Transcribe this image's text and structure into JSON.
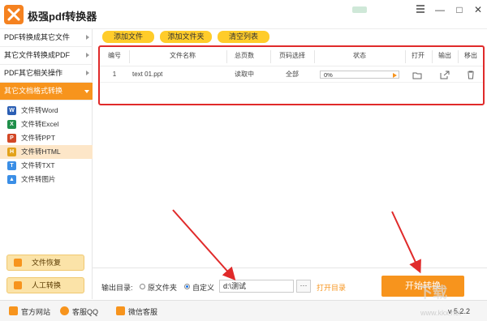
{
  "app": {
    "title": "极强pdf转换器",
    "window_controls": [
      "—",
      "□",
      "✕"
    ]
  },
  "sidebar": {
    "categories": [
      {
        "label": "PDF转换成其它文件",
        "active": false
      },
      {
        "label": "其它文件转换成PDF",
        "active": false
      },
      {
        "label": "PDF其它相关操作",
        "active": false
      },
      {
        "label": "其它文档格式转换",
        "active": true
      }
    ],
    "sub_items": [
      {
        "label": "文件转Word",
        "icon": "word-icon",
        "icon_color": "#2b5fb4",
        "active": false
      },
      {
        "label": "文件转Excel",
        "icon": "excel-icon",
        "icon_color": "#1f8f4a",
        "active": false
      },
      {
        "label": "文件转PPT",
        "icon": "ppt-icon",
        "icon_color": "#d24726",
        "active": false
      },
      {
        "label": "文件转HTML",
        "icon": "html-icon",
        "icon_color": "#e3a21a",
        "active": true
      },
      {
        "label": "文件转TXT",
        "icon": "txt-icon",
        "icon_color": "#3a8ee6",
        "active": false
      },
      {
        "label": "文件转图片",
        "icon": "image-icon",
        "icon_color": "#3a8ee6",
        "active": false
      }
    ],
    "bottom_buttons": [
      {
        "label": "文件恢复",
        "icon": "restore-icon"
      },
      {
        "label": "人工转换",
        "icon": "manual-convert-icon"
      }
    ]
  },
  "toolbar": {
    "add_file": "添加文件",
    "add_folder": "添加文件夹",
    "clear_list": "清空列表"
  },
  "table": {
    "headers": [
      "编号",
      "文件名称",
      "总页数",
      "页码选择",
      "状态",
      "打开",
      "输出",
      "移出"
    ],
    "rows": [
      {
        "index": "1",
        "filename": "text 01.ppt",
        "pages": "读取中",
        "page_select": "全部",
        "progress_text": "0%",
        "progress": 0.0
      }
    ]
  },
  "output": {
    "label": "输出目录:",
    "option_original": "原文件夹",
    "option_custom": "自定义",
    "selected": "custom",
    "path": "d:\\测试",
    "browse": "···",
    "open_dir": "打开目录",
    "start": "开始转换"
  },
  "statusbar": {
    "website": "官方网站",
    "qq": "客服QQ",
    "wechat": "微信客服",
    "version": "v 5.2.2"
  },
  "watermark": {
    "text": "下载",
    "url": "www.kkx.net"
  },
  "colors": {
    "accent": "#f7941d",
    "yellow_button": "#ffcc2a",
    "highlight_border": "#e02a2a",
    "open_dir_link": "#f7941d"
  }
}
